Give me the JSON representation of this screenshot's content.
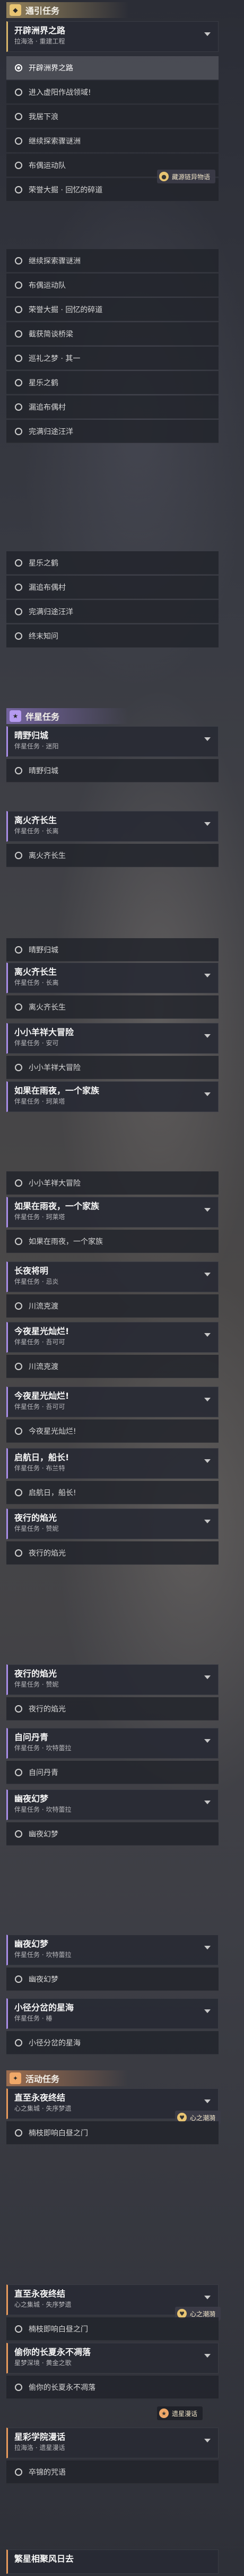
{
  "sections": {
    "main": {
      "label": "通引任务",
      "badge_icon": "quest-icon"
    },
    "companion": {
      "label": "伴星任务",
      "badge_icon": "star-icon"
    },
    "event": {
      "label": "活动任务",
      "badge_icon": "event-icon"
    }
  },
  "main_card": {
    "title": "开辟洲界之路",
    "subtitle": "拉海洛 · 重建工程"
  },
  "main_steps_a": [
    "开辟洲界之路",
    "进入虚阳作战领域!",
    "我居下浪",
    "继续探索骤谜洲",
    "布偶运动队",
    "荣誉大掘 · 回忆的碎道"
  ],
  "main_steps_b": [
    "继续探索骤谜洲",
    "布偶运动队",
    "荣誉大掘 · 回忆的碎道",
    "截获简谈桥梁",
    "巡礼之梦 · 其一",
    "星乐之鹤",
    "漏追布偶村",
    "完满归途汪洋"
  ],
  "main_steps_c": [
    "星乐之鹤",
    "漏追布偶村",
    "完满归途汪洋",
    "终末知问"
  ],
  "companion_cards": [
    {
      "title": "晴野归城",
      "subtitle": "伴星任务 · 迷阳"
    },
    {
      "title": "离火齐长生",
      "subtitle": "伴星任务 · 长离"
    },
    {
      "title": "离火齐长生",
      "subtitle": "伴星任务 · 长离"
    },
    {
      "title": "小小羊祥大冒险",
      "subtitle": "伴星任务 · 安可"
    },
    {
      "title": "如果在雨夜，一个家族",
      "subtitle": "伴星任务 · 珂莱塔"
    },
    {
      "title": "如果在雨夜，一个家族",
      "subtitle": "伴星任务 · 珂莱塔"
    },
    {
      "title": "长夜将明",
      "subtitle": "伴星任务 · 忌炎"
    },
    {
      "title": "今夜星光灿烂!",
      "subtitle": "伴星任务 · 吾可可"
    },
    {
      "title": "今夜星光灿烂!",
      "subtitle": "伴星任务 · 吾可可"
    },
    {
      "title": "启航日，船长!",
      "subtitle": "伴星任务 · 布兰特"
    },
    {
      "title": "夜行的焰光",
      "subtitle": "伴星任务 · 赞妮"
    },
    {
      "title": "夜行的焰光",
      "subtitle": "伴星任务 · 赞妮"
    },
    {
      "title": "自问丹青",
      "subtitle": "伴星任务 · 坎特蕾拉"
    },
    {
      "title": "幽夜幻梦",
      "subtitle": "伴星任务 · 坎特蕾拉"
    },
    {
      "title": "幽夜幻梦",
      "subtitle": "伴星任务 · 坎特蕾拉"
    },
    {
      "title": "小径分岔的星海",
      "subtitle": "伴星任务 · 椿"
    }
  ],
  "companion_steps": {
    "s1": "晴野归城",
    "s2": "离火齐长生",
    "s3a": "晴野归城",
    "s3b": "离火齐长生",
    "s4": "小小羊祥大冒险",
    "s5a": "小小羊祥大冒险",
    "s5b": "如果在雨夜，一个家族",
    "s6": "如果在雨夜，一个家族",
    "s7": "川流克渡",
    "s8": "今夜星光灿烂!",
    "s9": "川流克渡",
    "s10": "今夜星光灿烂!",
    "s11": "启航日，船长!",
    "s12": "夜行的焰光",
    "s13": "夜行的焰光",
    "s14": "自问丹青",
    "s15": "幽夜幻梦",
    "s16": "幽夜幻梦",
    "s17": "小径分岔的星海"
  },
  "event_cards": [
    {
      "title": "直至永夜终结",
      "subtitle": "心之集城 · 失序梦遗"
    },
    {
      "title": "直至永夜终结",
      "subtitle": "心之集城 · 失序梦遗"
    },
    {
      "title": "偷你的长夏永不凋落",
      "subtitle": "星梦深境 · 黄金之歌"
    },
    {
      "title": "星彩学院漫话",
      "subtitle": "拉海洛 · 遗星漫话"
    },
    {
      "title": "繁星相聚风日去",
      "subtitle": ""
    }
  ],
  "event_steps": [
    "楠枝即响白昼之门",
    "楠枝即响白昼之门",
    "偷你的长夏永不凋落",
    "卒锦的咒语"
  ],
  "tags": {
    "t1": "藏源链异物语",
    "t2": "心之潮漪",
    "t3": "心之潮漪",
    "t4": "遗星漫话"
  },
  "colors": {
    "gold": "#e8c472",
    "purple": "#b59bf0",
    "orange": "#f0a868"
  }
}
